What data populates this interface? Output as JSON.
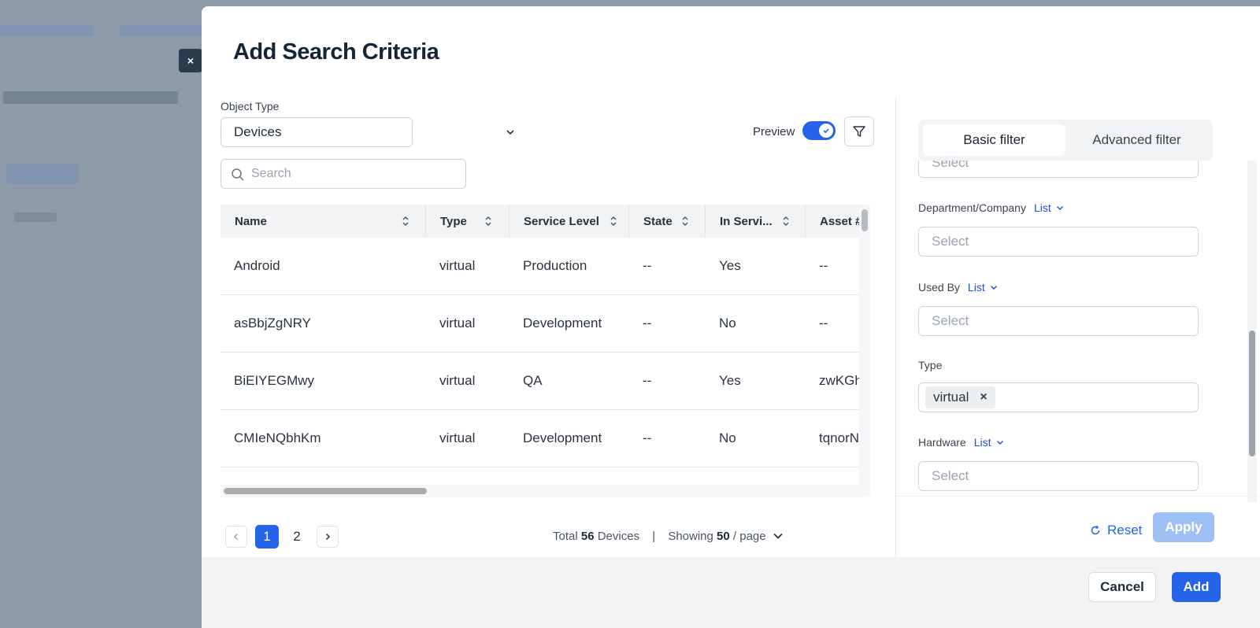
{
  "background": {
    "close_label": "×"
  },
  "modal": {
    "title": "Add Search Criteria",
    "object_type_label": "Object Type",
    "object_type_value": "Devices",
    "preview_label": "Preview",
    "preview_on": true,
    "search_placeholder": "Search"
  },
  "table": {
    "columns": [
      "Name",
      "Type",
      "Service Level",
      "State",
      "In Servi...",
      "Asset #"
    ],
    "rows": [
      [
        "Android",
        "virtual",
        "Production",
        "--",
        "Yes",
        "--"
      ],
      [
        "asBbjZgNRY",
        "virtual",
        "Development",
        "--",
        "No",
        "--"
      ],
      [
        "BiEIYEGMwy",
        "virtual",
        "QA",
        "--",
        "Yes",
        "zwKGh"
      ],
      [
        "CMIeNQbhKm",
        "virtual",
        "Development",
        "--",
        "No",
        "tqnorN"
      ]
    ]
  },
  "pagination": {
    "prev": "‹",
    "next": "›",
    "pages": [
      "1",
      "2"
    ],
    "total_prefix": "Total",
    "total_count": "56",
    "total_suffix": "Devices",
    "separator": "|",
    "showing_prefix": "Showing",
    "page_size": "50",
    "page_size_suffix": "/ page"
  },
  "filter": {
    "tabs": [
      "Basic filter",
      "Advanced filter"
    ],
    "active_tab": "Basic filter",
    "top_select_placeholder": "Select",
    "fields": [
      {
        "label": "Department/Company",
        "link": "List",
        "placeholder": "Select"
      },
      {
        "label": "Used By",
        "link": "List",
        "placeholder": "Select"
      },
      {
        "label": "Type",
        "chip": "virtual",
        "chip_remove": "×"
      },
      {
        "label": "Hardware",
        "link": "List",
        "placeholder": "Select"
      }
    ],
    "reset_label": "Reset",
    "apply_label": "Apply"
  },
  "footer": {
    "cancel_label": "Cancel",
    "add_label": "Add"
  },
  "colors": {
    "primary": "#2563eb",
    "apply_disabled": "#9ec0f5",
    "title": "#152538"
  }
}
